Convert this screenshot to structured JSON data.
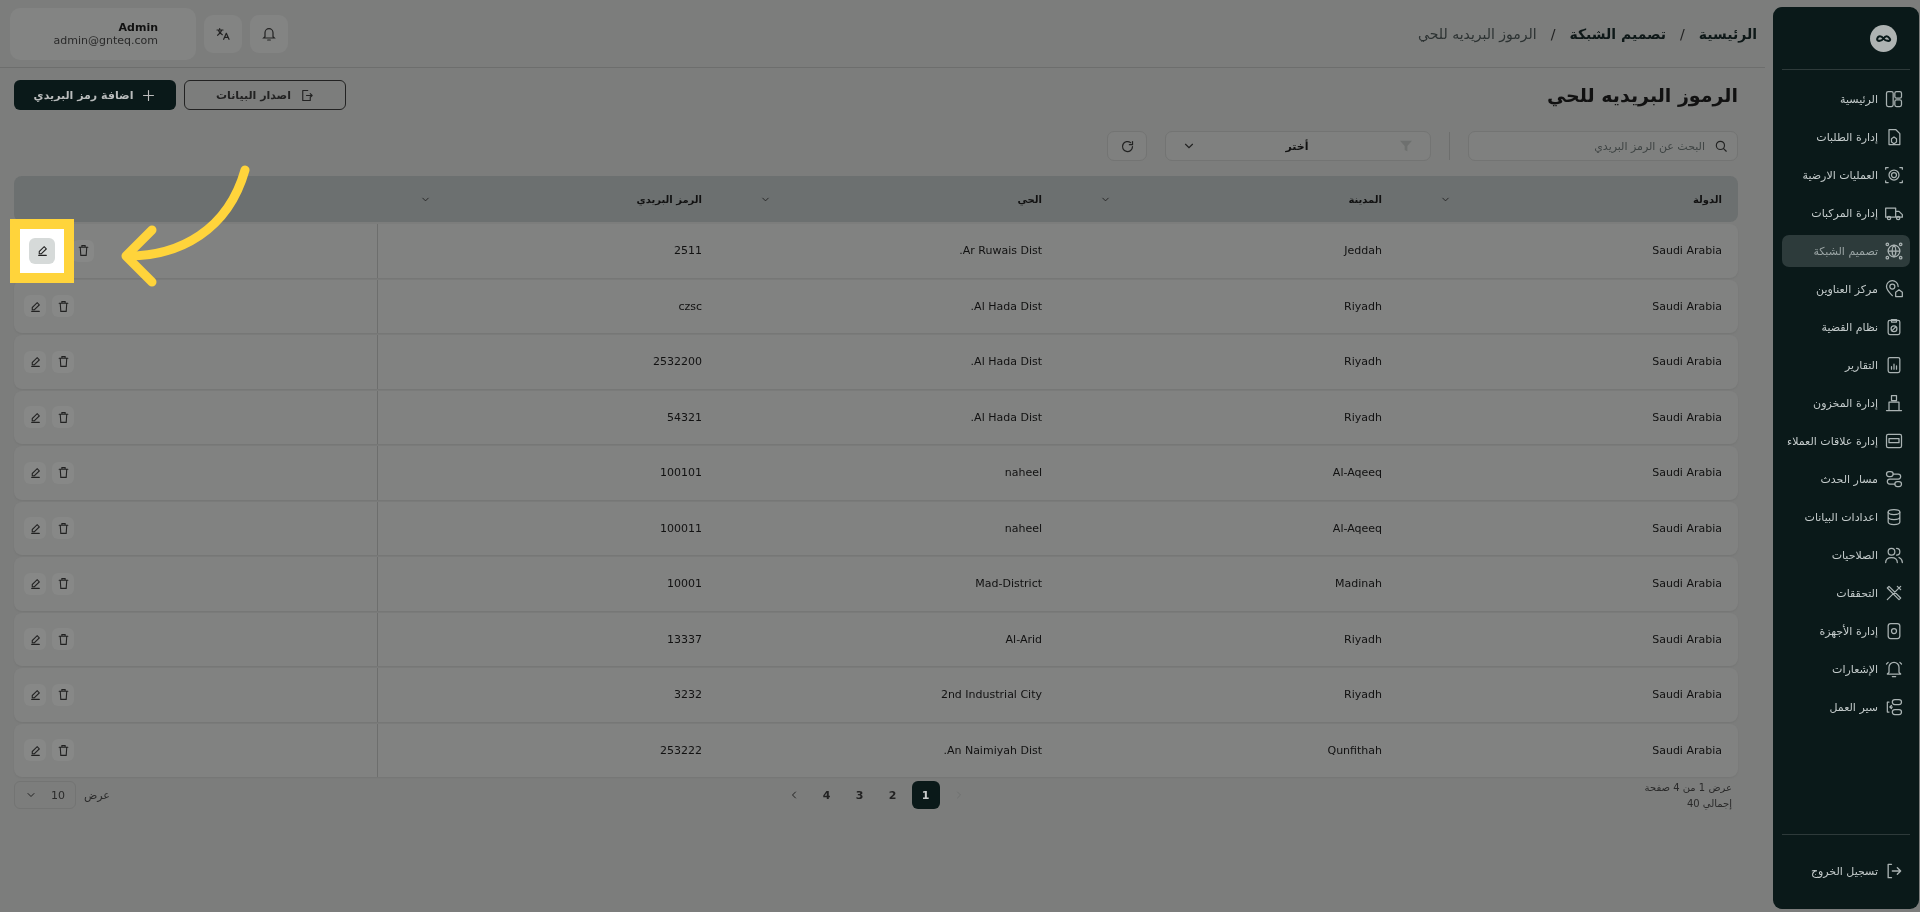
{
  "sidebar": {
    "items": [
      {
        "label": "الرئيسية",
        "selected": false
      },
      {
        "label": "إدارة الطلبات",
        "selected": false
      },
      {
        "label": "العمليات الارضية",
        "selected": false
      },
      {
        "label": "إدارة المركبات",
        "selected": false
      },
      {
        "label": "تصميم الشبكة",
        "selected": true
      },
      {
        "label": "مركز العناوين",
        "selected": false
      },
      {
        "label": "نظام القضية",
        "selected": false
      },
      {
        "label": "التقارير",
        "selected": false
      },
      {
        "label": "إدارة المخزون",
        "selected": false
      },
      {
        "label": "إدارة علاقات العملاء",
        "selected": false
      },
      {
        "label": "مسار الحدث",
        "selected": false
      },
      {
        "label": "اعدادات البيانات",
        "selected": false
      },
      {
        "label": "الصلاحيات",
        "selected": false
      },
      {
        "label": "التحققات",
        "selected": false
      },
      {
        "label": "إدارة الأجهزة",
        "selected": false
      },
      {
        "label": "الإشعارات",
        "selected": false
      },
      {
        "label": "سير العمل",
        "selected": false
      }
    ],
    "logout": "تسجيل الخروج"
  },
  "header": {
    "breadcrumb": [
      {
        "kind": "link",
        "label": "الرئيسية",
        "current": false
      },
      {
        "kind": "separator",
        "label": "/"
      },
      {
        "kind": "link",
        "label": "تصميم الشبكة",
        "current": false
      },
      {
        "kind": "separator",
        "label": "/"
      },
      {
        "kind": "link",
        "label": "الرموز البريديه للحي",
        "current": true
      }
    ],
    "user": {
      "name": "Admin",
      "email": "admin@gnteq.com"
    }
  },
  "page": {
    "title": "الرموز البريديه للحي",
    "export_button": "اصدار البيانات",
    "add_button": "اضافة رمز البريدي"
  },
  "toolbar": {
    "search": {
      "placeholder": "البحث عن الرمز البريدي"
    },
    "filter": {
      "value": "أختر"
    }
  },
  "table": {
    "columns": [
      "الدولة",
      "المدينة",
      "الحي",
      "الرمز البريدي"
    ],
    "rows": [
      {
        "country": "Saudi Arabia",
        "city": "Jeddah",
        "district": "Ar Ruwais Dist.",
        "postal_code": "2511",
        "edit_highlighted": true
      },
      {
        "country": "Saudi Arabia",
        "city": "Riyadh",
        "district": "Al Hada Dist.",
        "postal_code": "czsc",
        "edit_highlighted": false
      },
      {
        "country": "Saudi Arabia",
        "city": "Riyadh",
        "district": "Al Hada Dist.",
        "postal_code": "2532200",
        "edit_highlighted": false
      },
      {
        "country": "Saudi Arabia",
        "city": "Riyadh",
        "district": "Al Hada Dist.",
        "postal_code": "54321",
        "edit_highlighted": false
      },
      {
        "country": "Saudi Arabia",
        "city": "Al-Aqeeq",
        "district": "naheel",
        "postal_code": "100101",
        "edit_highlighted": false
      },
      {
        "country": "Saudi Arabia",
        "city": "Al-Aqeeq",
        "district": "naheel",
        "postal_code": "100011",
        "edit_highlighted": false
      },
      {
        "country": "Saudi Arabia",
        "city": "Madinah",
        "district": "Mad-District",
        "postal_code": "10001",
        "edit_highlighted": false
      },
      {
        "country": "Saudi Arabia",
        "city": "Riyadh",
        "district": "Al-Arid",
        "postal_code": "13337",
        "edit_highlighted": false
      },
      {
        "country": "Saudi Arabia",
        "city": "Riyadh",
        "district": "2nd Industrial City",
        "postal_code": "3232",
        "edit_highlighted": false
      },
      {
        "country": "Saudi Arabia",
        "city": "Qunfithah",
        "district": "An Naimiyah Dist.",
        "postal_code": "253222",
        "edit_highlighted": false
      }
    ]
  },
  "pagination": {
    "info": "عرض 1 من 4 صفحة",
    "total": "إجمالي 40",
    "prev_disabled": true,
    "next_disabled": false,
    "pages": [
      {
        "label": "1",
        "selected": true
      },
      {
        "label": "2",
        "selected": false
      },
      {
        "label": "3",
        "selected": false
      },
      {
        "label": "4",
        "selected": false
      }
    ],
    "page_size_label": "عرض",
    "page_size": "10"
  }
}
